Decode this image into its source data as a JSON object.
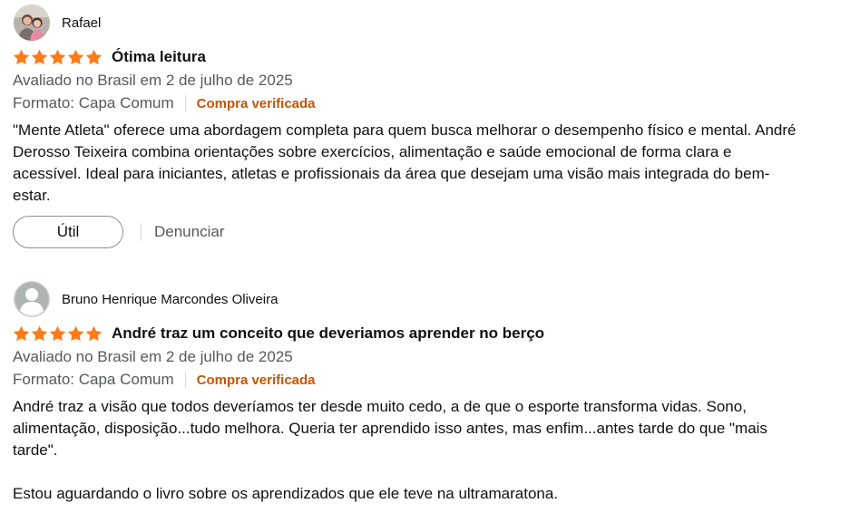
{
  "reviews": [
    {
      "reviewer": "Rafael",
      "avatar": "photo-avatar",
      "rating": 5,
      "title": "Ótima leitura",
      "meta": "Avaliado no Brasil em 2 de julho de 2025",
      "format": "Formato: Capa Comum",
      "verified": "Compra verificada",
      "body": [
        "\"Mente Atleta\" oferece uma abordagem completa para quem busca melhorar o desempenho físico e mental. André Derosso Teixeira combina orientações sobre exercícios, alimentação e saúde emocional de forma clara e acessível. Ideal para iniciantes, atletas e profissionais da área que desejam uma visão mais integrada do bem-estar."
      ],
      "helpful_label": "Útil",
      "report_label": "Denunciar"
    },
    {
      "reviewer": "Bruno Henrique Marcondes Oliveira",
      "avatar": "default-user-icon",
      "rating": 5,
      "title": "André traz um conceito que deveriamos aprender no berço",
      "meta": "Avaliado no Brasil em 2 de julho de 2025",
      "format": "Formato: Capa Comum",
      "verified": "Compra verificada",
      "body": [
        "André traz a visão que todos deveríamos ter desde muito cedo, a de que o esporte transforma vidas. Sono, alimentação, disposição...tudo melhora. Queria ter aprendido isso antes, mas enfim...antes tarde do que \"mais tarde\".",
        "Estou aguardando o livro sobre os aprendizados que ele teve na ultramaratona."
      ]
    }
  ],
  "colors": {
    "star": "#ff7b1a",
    "verified": "#c45500",
    "secondary_text": "#565959",
    "primary_text": "#0f1111"
  }
}
